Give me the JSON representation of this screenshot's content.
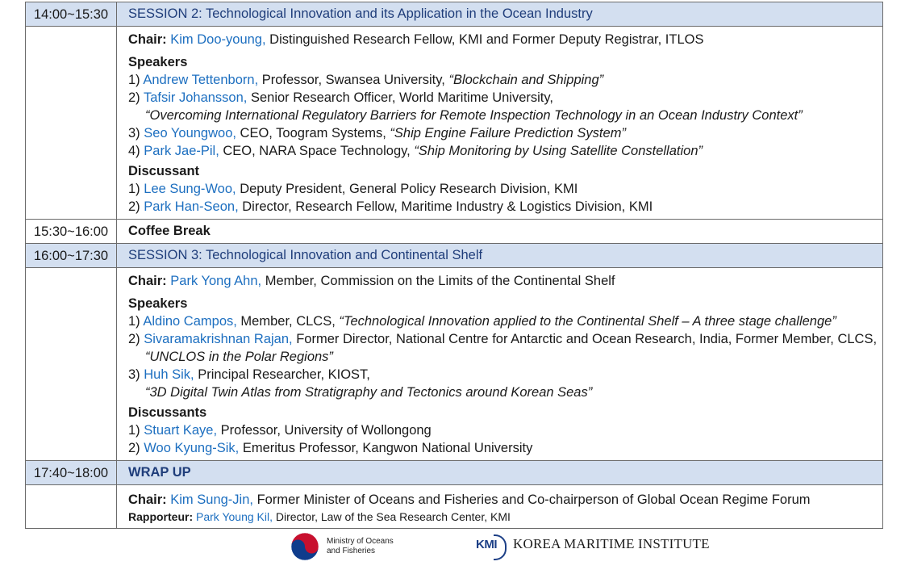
{
  "session2": {
    "time": "14:00~15:30",
    "title": "SESSION 2: Technological Innovation and its Application in the Ocean Industry",
    "chair_label": "Chair:",
    "chair_name": "Kim Doo-young,",
    "chair_desc": " Distinguished Research Fellow, KMI and Former Deputy Registrar, ITLOS",
    "speakers_label": "Speakers",
    "speakers": [
      {
        "num": "1) ",
        "name": "Andrew Tettenborn,",
        "desc": " Professor, Swansea University, ",
        "title": "“Blockchain and Shipping”"
      },
      {
        "num": "2) ",
        "name": "Tafsir Johansson,",
        "desc": " Senior Research Officer, World Maritime University,",
        "title": ""
      },
      {
        "num": "3) ",
        "name": "Seo Youngwoo,",
        "desc": " CEO, Toogram Systems, ",
        "title": "“Ship Engine Failure Prediction System”"
      },
      {
        "num": "4) ",
        "name": "Park Jae-Pil,",
        "desc": " CEO, NARA Space Technology, ",
        "title": "“Ship Monitoring by Using Satellite Constellation”"
      }
    ],
    "speaker2_title_line": "“Overcoming International Regulatory Barriers for Remote Inspection Technology in an Ocean Industry Context”",
    "discussant_label": "Discussant",
    "discussants": [
      {
        "num": "1) ",
        "name": "Lee Sung-Woo,",
        "desc": " Deputy President, General Policy Research Division, KMI"
      },
      {
        "num": "2) ",
        "name": "Park Han-Seon,",
        "desc": " Director, Research Fellow, Maritime Industry & Logistics Division, KMI"
      }
    ]
  },
  "coffee": {
    "time": "15:30~16:00",
    "title": "Coffee Break"
  },
  "session3": {
    "time": "16:00~17:30",
    "title": "SESSION 3: Technological Innovation and Continental Shelf",
    "chair_label": "Chair:",
    "chair_name": "Park Yong Ahn,",
    "chair_desc": " Member, Commission on the Limits of the Continental Shelf",
    "speakers_label": "Speakers",
    "speaker1": {
      "num": "1) ",
      "name": "Aldino Campos,",
      "desc": " Member, CLCS, ",
      "title": "“Technological Innovation applied to the Continental Shelf – A three stage challenge”"
    },
    "speaker2": {
      "num": "2) ",
      "name": "Sivaramakrishnan Rajan,",
      "desc": " Former Director, National Centre for Antarctic and Ocean Research, India, Former Member, CLCS,",
      "title": "“UNCLOS in the Polar Regions”"
    },
    "speaker3": {
      "num": "3) ",
      "name": "Huh Sik,",
      "desc": " Principal Researcher, KIOST,",
      "title": "“3D Digital Twin Atlas from Stratigraphy and Tectonics around Korean Seas”"
    },
    "discussants_label": "Discussants",
    "discussants": [
      {
        "num": "1) ",
        "name": "Stuart Kaye,",
        "desc": " Professor, University of Wollongong"
      },
      {
        "num": "2) ",
        "name": "Woo Kyung-Sik,",
        "desc": " Emeritus Professor, Kangwon National University"
      }
    ]
  },
  "wrapup": {
    "time": "17:40~18:00",
    "title": "WRAP UP",
    "chair_label": "Chair:",
    "chair_name": "Kim Sung-Jin,",
    "chair_desc": " Former Minister of Oceans and Fisheries and Co-chairperson of Global Ocean Regime Forum",
    "rapporteur_label": "Rapporteur:",
    "rapporteur_name": "Park Young Kil,",
    "rapporteur_desc": " Director, Law of the Sea Research Center, KMI"
  },
  "logos": {
    "mof_line1": "Ministry of Oceans",
    "mof_line2": "and Fisheries",
    "kmi_badge": "KMI",
    "kmi_name": "KOREA MARITIME INSTITUTE",
    "mof_icon": "taegeuk-emblem-icon",
    "colors": {
      "blue": "#1d6fc0",
      "header_bg": "#d3dff0",
      "header_text": "#1f3d7a",
      "mof_red": "#c8102e",
      "mof_blue": "#0f3c8c"
    }
  }
}
